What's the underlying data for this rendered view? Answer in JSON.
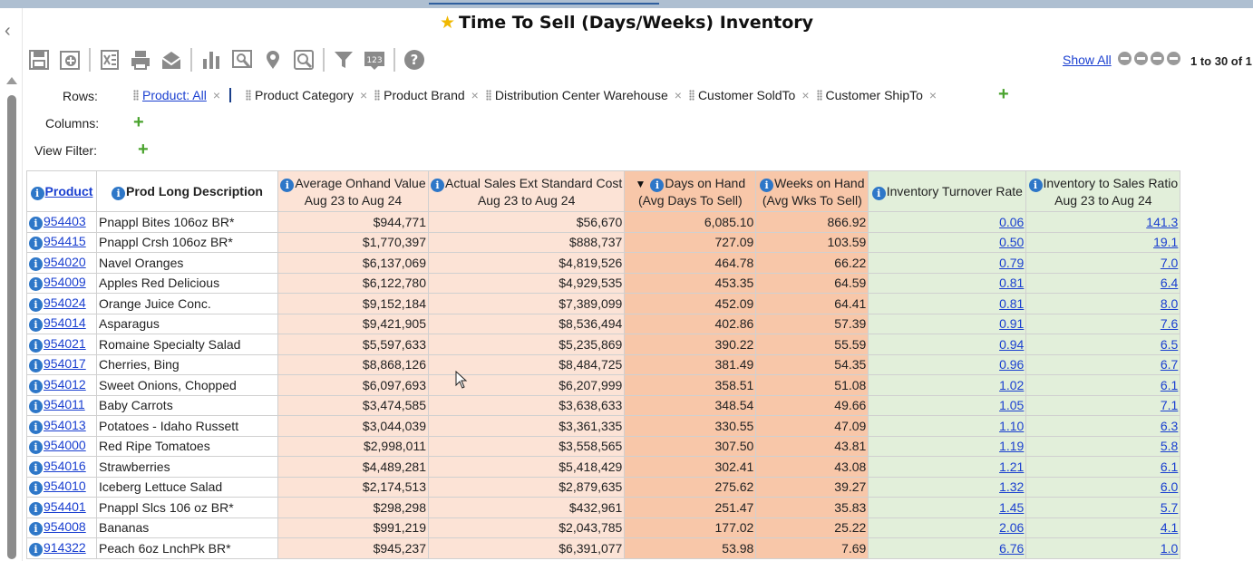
{
  "title": "Time To Sell (Days/Weeks) Inventory",
  "icons": {
    "star": "star-icon",
    "collapse": "chevron-left-icon",
    "toolbar": [
      "save-icon",
      "add-icon",
      "excel-icon",
      "print-icon",
      "email-icon",
      "bar-chart-icon",
      "zoom-icon",
      "map-pin-icon",
      "search-icon",
      "filter-icon",
      "number-format-icon",
      "help-icon"
    ]
  },
  "colors": {
    "link": "#1a3fd0",
    "info": "#2e77c8",
    "add": "#4aa32e",
    "col_peach": "#fce3d6",
    "col_orange": "#f8c7a9",
    "col_green": "#e2efda"
  },
  "pager": {
    "show_all": "Show All",
    "range": "1 to 30 of 1"
  },
  "pivot": {
    "rows_label": "Rows:",
    "columns_label": "Columns:",
    "view_filter_label": "View Filter:",
    "rows": [
      "Product: All",
      "Product Category",
      "Product Brand",
      "Distribution Center Warehouse",
      "Customer SoldTo",
      "Customer ShipTo"
    ],
    "add_symbol": "+",
    "remove_symbol": "×"
  },
  "table": {
    "columns": [
      {
        "line1": "Product",
        "line2": ""
      },
      {
        "line1": "Prod Long Description",
        "line2": ""
      },
      {
        "line1": "Average Onhand Value",
        "line2": "Aug 23 to Aug 24"
      },
      {
        "line1": "Actual Sales Ext Standard Cost",
        "line2": "Aug 23 to Aug 24"
      },
      {
        "line1": "Days on Hand",
        "line2": "(Avg Days To Sell)"
      },
      {
        "line1": "Weeks on Hand",
        "line2": "(Avg Wks To Sell)"
      },
      {
        "line1": "Inventory Turnover Rate",
        "line2": ""
      },
      {
        "line1": "Inventory to Sales Ratio",
        "line2": "Aug 23 to Aug 24"
      }
    ],
    "rows": [
      [
        "954403",
        "Pnappl Bites 106oz BR*",
        "$944,771",
        "$56,670",
        "6,085.10",
        "866.92",
        "0.06",
        "141.3"
      ],
      [
        "954415",
        "Pnappl Crsh 106oz BR*",
        "$1,770,397",
        "$888,737",
        "727.09",
        "103.59",
        "0.50",
        "19.1"
      ],
      [
        "954020",
        "Navel Oranges",
        "$6,137,069",
        "$4,819,526",
        "464.78",
        "66.22",
        "0.79",
        "7.0"
      ],
      [
        "954009",
        "Apples Red Delicious",
        "$6,122,780",
        "$4,929,535",
        "453.35",
        "64.59",
        "0.81",
        "6.4"
      ],
      [
        "954024",
        "Orange Juice Conc.",
        "$9,152,184",
        "$7,389,099",
        "452.09",
        "64.41",
        "0.81",
        "8.0"
      ],
      [
        "954014",
        "Asparagus",
        "$9,421,905",
        "$8,536,494",
        "402.86",
        "57.39",
        "0.91",
        "7.6"
      ],
      [
        "954021",
        "Romaine Specialty Salad",
        "$5,597,633",
        "$5,235,869",
        "390.22",
        "55.59",
        "0.94",
        "6.5"
      ],
      [
        "954017",
        "Cherries, Bing",
        "$8,868,126",
        "$8,484,725",
        "381.49",
        "54.35",
        "0.96",
        "6.7"
      ],
      [
        "954012",
        "Sweet Onions, Chopped",
        "$6,097,693",
        "$6,207,999",
        "358.51",
        "51.08",
        "1.02",
        "6.1"
      ],
      [
        "954011",
        "Baby Carrots",
        "$3,474,585",
        "$3,638,633",
        "348.54",
        "49.66",
        "1.05",
        "7.1"
      ],
      [
        "954013",
        "Potatoes - Idaho Russett",
        "$3,044,039",
        "$3,361,335",
        "330.55",
        "47.09",
        "1.10",
        "6.3"
      ],
      [
        "954000",
        "Red Ripe Tomatoes",
        "$2,998,011",
        "$3,558,565",
        "307.50",
        "43.81",
        "1.19",
        "5.8"
      ],
      [
        "954016",
        "Strawberries",
        "$4,489,281",
        "$5,418,429",
        "302.41",
        "43.08",
        "1.21",
        "6.1"
      ],
      [
        "954010",
        "Iceberg Lettuce Salad",
        "$2,174,513",
        "$2,879,635",
        "275.62",
        "39.27",
        "1.32",
        "6.0"
      ],
      [
        "954401",
        "Pnappl Slcs 106 oz BR*",
        "$298,298",
        "$432,961",
        "251.47",
        "35.83",
        "1.45",
        "5.7"
      ],
      [
        "954008",
        "Bananas",
        "$991,219",
        "$2,043,785",
        "177.02",
        "25.22",
        "2.06",
        "4.1"
      ],
      [
        "914322",
        "Peach 6oz LnchPk BR*",
        "$945,237",
        "$6,391,077",
        "53.98",
        "7.69",
        "6.76",
        "1.0"
      ]
    ]
  }
}
